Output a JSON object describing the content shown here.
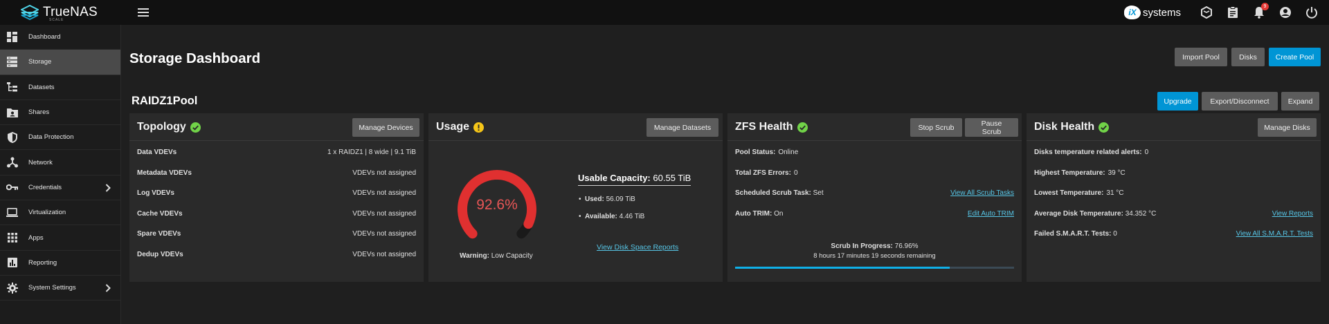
{
  "app": {
    "logo_text": "TrueNAS",
    "logo_sub": "SCALE",
    "ix_badge": "iX",
    "ix_text": "systems",
    "notification_count": "9",
    "accent": "#0095d5"
  },
  "sidebar": {
    "items": [
      {
        "label": "Dashboard",
        "icon": "dashboard-icon",
        "active": false
      },
      {
        "label": "Storage",
        "icon": "storage-icon",
        "active": true
      },
      {
        "label": "Datasets",
        "icon": "datasets-icon",
        "active": false
      },
      {
        "label": "Shares",
        "icon": "shares-icon",
        "active": false
      },
      {
        "label": "Data Protection",
        "icon": "shield-icon",
        "active": false
      },
      {
        "label": "Network",
        "icon": "network-icon",
        "active": false
      },
      {
        "label": "Credentials",
        "icon": "key-icon",
        "active": false,
        "chevron": true
      },
      {
        "label": "Virtualization",
        "icon": "laptop-icon",
        "active": false
      },
      {
        "label": "Apps",
        "icon": "apps-grid-icon",
        "active": false
      },
      {
        "label": "Reporting",
        "icon": "reporting-icon",
        "active": false
      },
      {
        "label": "System Settings",
        "icon": "gear-icon",
        "active": false,
        "chevron": true
      }
    ]
  },
  "header": {
    "title": "Storage Dashboard",
    "import_pool": "Import Pool",
    "disks": "Disks",
    "create_pool": "Create Pool"
  },
  "pool": {
    "name": "RAIDZ1Pool",
    "upgrade": "Upgrade",
    "export_disconnect": "Export/Disconnect",
    "expand": "Expand"
  },
  "topology": {
    "title": "Topology",
    "manage_button": "Manage Devices",
    "rows": [
      {
        "label": "Data VDEVs",
        "value": "1 x RAIDZ1 | 8 wide | 9.1 TiB"
      },
      {
        "label": "Metadata VDEVs",
        "value": "VDEVs not assigned"
      },
      {
        "label": "Log VDEVs",
        "value": "VDEVs not assigned"
      },
      {
        "label": "Cache VDEVs",
        "value": "VDEVs not assigned"
      },
      {
        "label": "Spare VDEVs",
        "value": "VDEVs not assigned"
      },
      {
        "label": "Dedup VDEVs",
        "value": "VDEVs not assigned"
      }
    ]
  },
  "usage": {
    "title": "Usage",
    "manage_button": "Manage Datasets",
    "gauge_value": "92.6%",
    "gauge_fraction": 0.926,
    "warning_label": "Warning:",
    "warning_text": "Low Capacity",
    "capacity_label": "Usable Capacity:",
    "capacity_value": "60.55 TiB",
    "used_label": "Used:",
    "used_value": "56.09 TiB",
    "available_label": "Available:",
    "available_value": "4.46 TiB",
    "report_link": "View Disk Space Reports",
    "gauge_color": "#e03030"
  },
  "zfs": {
    "title": "ZFS Health",
    "stop_scrub": "Stop Scrub",
    "pause_scrub": "Pause Scrub",
    "pool_status_label": "Pool Status:",
    "pool_status_value": "Online",
    "errors_label": "Total ZFS Errors:",
    "errors_value": "0",
    "scrub_task_label": "Scheduled Scrub Task:",
    "scrub_task_value": "Set",
    "scrub_task_link": "View All Scrub Tasks",
    "autotrim_label": "Auto TRIM:",
    "autotrim_value": "On",
    "autotrim_link": "Edit Auto TRIM",
    "scrub_progress_label": "Scrub In Progress:",
    "scrub_progress_value": "76.96%",
    "scrub_fraction": 0.7696,
    "scrub_remaining": "8 hours 17 minutes 19 seconds remaining"
  },
  "disk_health": {
    "title": "Disk Health",
    "manage_button": "Manage Disks",
    "alerts_label": "Disks temperature related alerts:",
    "alerts_value": "0",
    "highest_label": "Highest Temperature:",
    "highest_value": "39 °C",
    "lowest_label": "Lowest Temperature:",
    "lowest_value": "31 °C",
    "avg_label": "Average Disk Temperature:",
    "avg_value": "34.352 °C",
    "reports_link": "View Reports",
    "smart_label": "Failed S.M.A.R.T. Tests:",
    "smart_value": "0",
    "smart_link": "View All S.M.A.R.T. Tests"
  }
}
